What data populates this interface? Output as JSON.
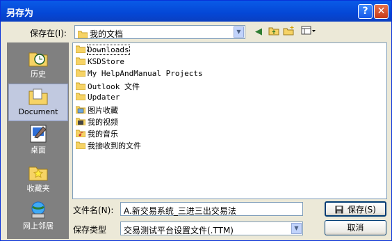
{
  "window": {
    "title": "另存为"
  },
  "save_in": {
    "label": "保存在(I):",
    "value": "我的文档"
  },
  "places": [
    {
      "label": "历史",
      "icon": "history-icon"
    },
    {
      "label": "Document",
      "icon": "documents-icon",
      "selected": true
    },
    {
      "label": "桌面",
      "icon": "desktop-icon"
    },
    {
      "label": "收藏夹",
      "icon": "favorites-icon"
    },
    {
      "label": "网上邻居",
      "icon": "network-icon"
    }
  ],
  "files": [
    {
      "name": "Downloads",
      "icon": "folder-icon"
    },
    {
      "name": "KSDStore",
      "icon": "folder-icon"
    },
    {
      "name": "My HelpAndManual Projects",
      "icon": "folder-icon"
    },
    {
      "name": "Outlook 文件",
      "icon": "folder-icon"
    },
    {
      "name": "Updater",
      "icon": "folder-icon"
    },
    {
      "name": "图片收藏",
      "icon": "pictures-folder-icon"
    },
    {
      "name": "我的视频",
      "icon": "video-folder-icon"
    },
    {
      "name": "我的音乐",
      "icon": "music-folder-icon"
    },
    {
      "name": "我接收到的文件",
      "icon": "folder-icon"
    }
  ],
  "filename": {
    "label": "文件名(N):",
    "value": "A.新交易系统_三进三出交易法"
  },
  "filetype": {
    "label": "保存类型",
    "value": "交易测试平台设置文件(.TTM)"
  },
  "buttons": {
    "save": "保存(S)",
    "cancel": "取消"
  },
  "colors": {
    "title_bar": "#0447D6",
    "dialog_bg": "#ECE9D8",
    "places_bg": "#808080",
    "folder": "#F6D365"
  }
}
